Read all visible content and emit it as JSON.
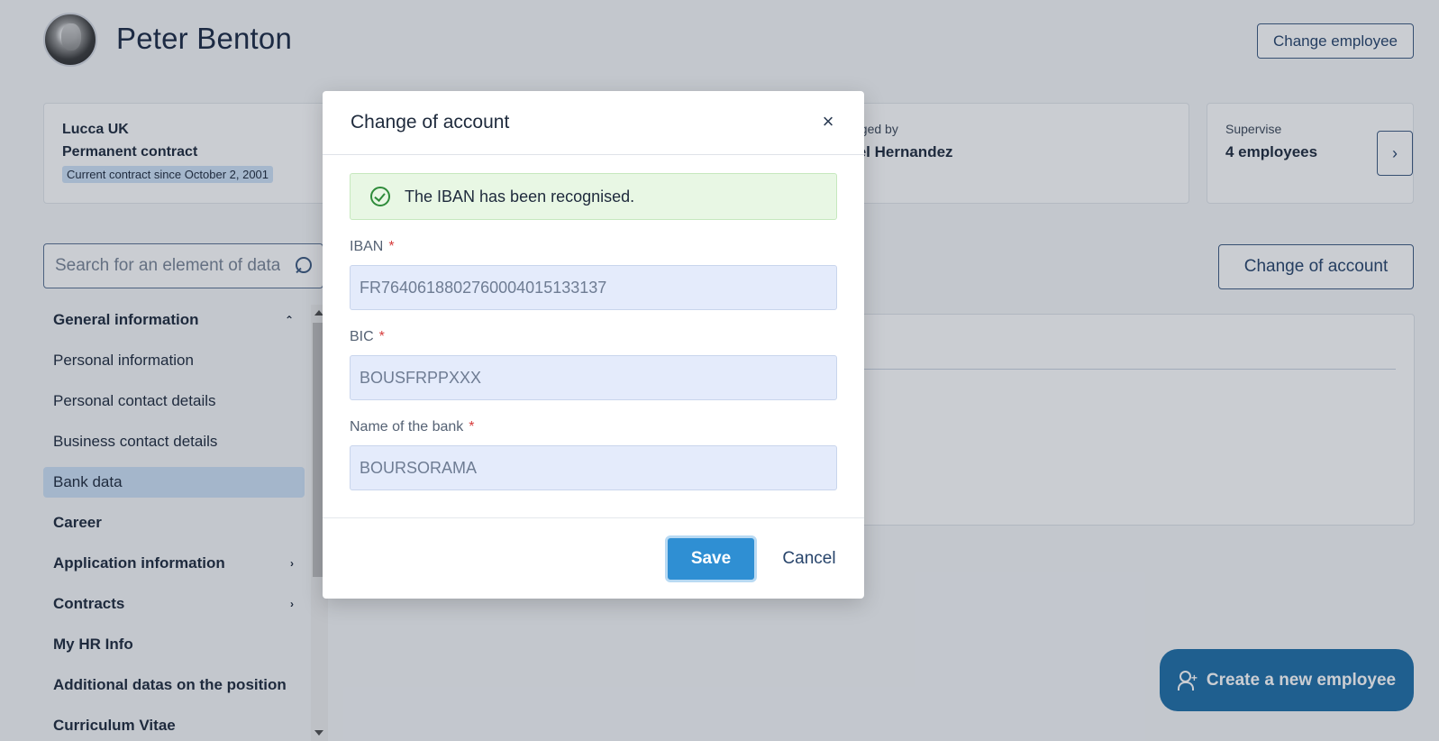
{
  "employee": {
    "name": "Peter Benton",
    "change_label": "Change employee"
  },
  "cards": {
    "contract": {
      "company": "Lucca UK",
      "type": "Permanent contract",
      "since": "Current contract since October 2, 2001"
    },
    "manager": {
      "label": "aged by",
      "name": "iel Hernandez"
    },
    "supervise": {
      "label": "Supervise",
      "value": "4 employees",
      "next_icon": "chevron-right-icon"
    }
  },
  "search": {
    "placeholder": "Search for an element of data"
  },
  "sidebar": {
    "items": [
      {
        "label": "General information",
        "bold": true,
        "chevron": "⌃"
      },
      {
        "label": "Personal information"
      },
      {
        "label": "Personal contact details"
      },
      {
        "label": "Business contact details"
      },
      {
        "label": "Bank data",
        "active": true
      },
      {
        "label": "Career",
        "bold": true
      },
      {
        "label": "Application information",
        "bold": true,
        "chevron": "›"
      },
      {
        "label": "Contracts",
        "bold": true,
        "chevron": "›"
      },
      {
        "label": "My HR Info",
        "bold": true
      },
      {
        "label": "Additional datas on the position",
        "bold": true
      },
      {
        "label": "Curriculum Vitae",
        "bold": true
      }
    ]
  },
  "main": {
    "change_account_label": "Change of account"
  },
  "create_button": {
    "label": "Create a new employee"
  },
  "modal": {
    "title": "Change of account",
    "close_icon": "×",
    "success_message": "The IBAN has been recognised.",
    "required_mark": "*",
    "fields": {
      "iban": {
        "label": "IBAN",
        "value": "FR7640618802760004015133137"
      },
      "bic": {
        "label": "BIC",
        "value": "BOUSFRPPXXX"
      },
      "bank": {
        "label": "Name of the bank",
        "value": "BOURSORAMA"
      }
    },
    "save_label": "Save",
    "cancel_label": "Cancel"
  }
}
